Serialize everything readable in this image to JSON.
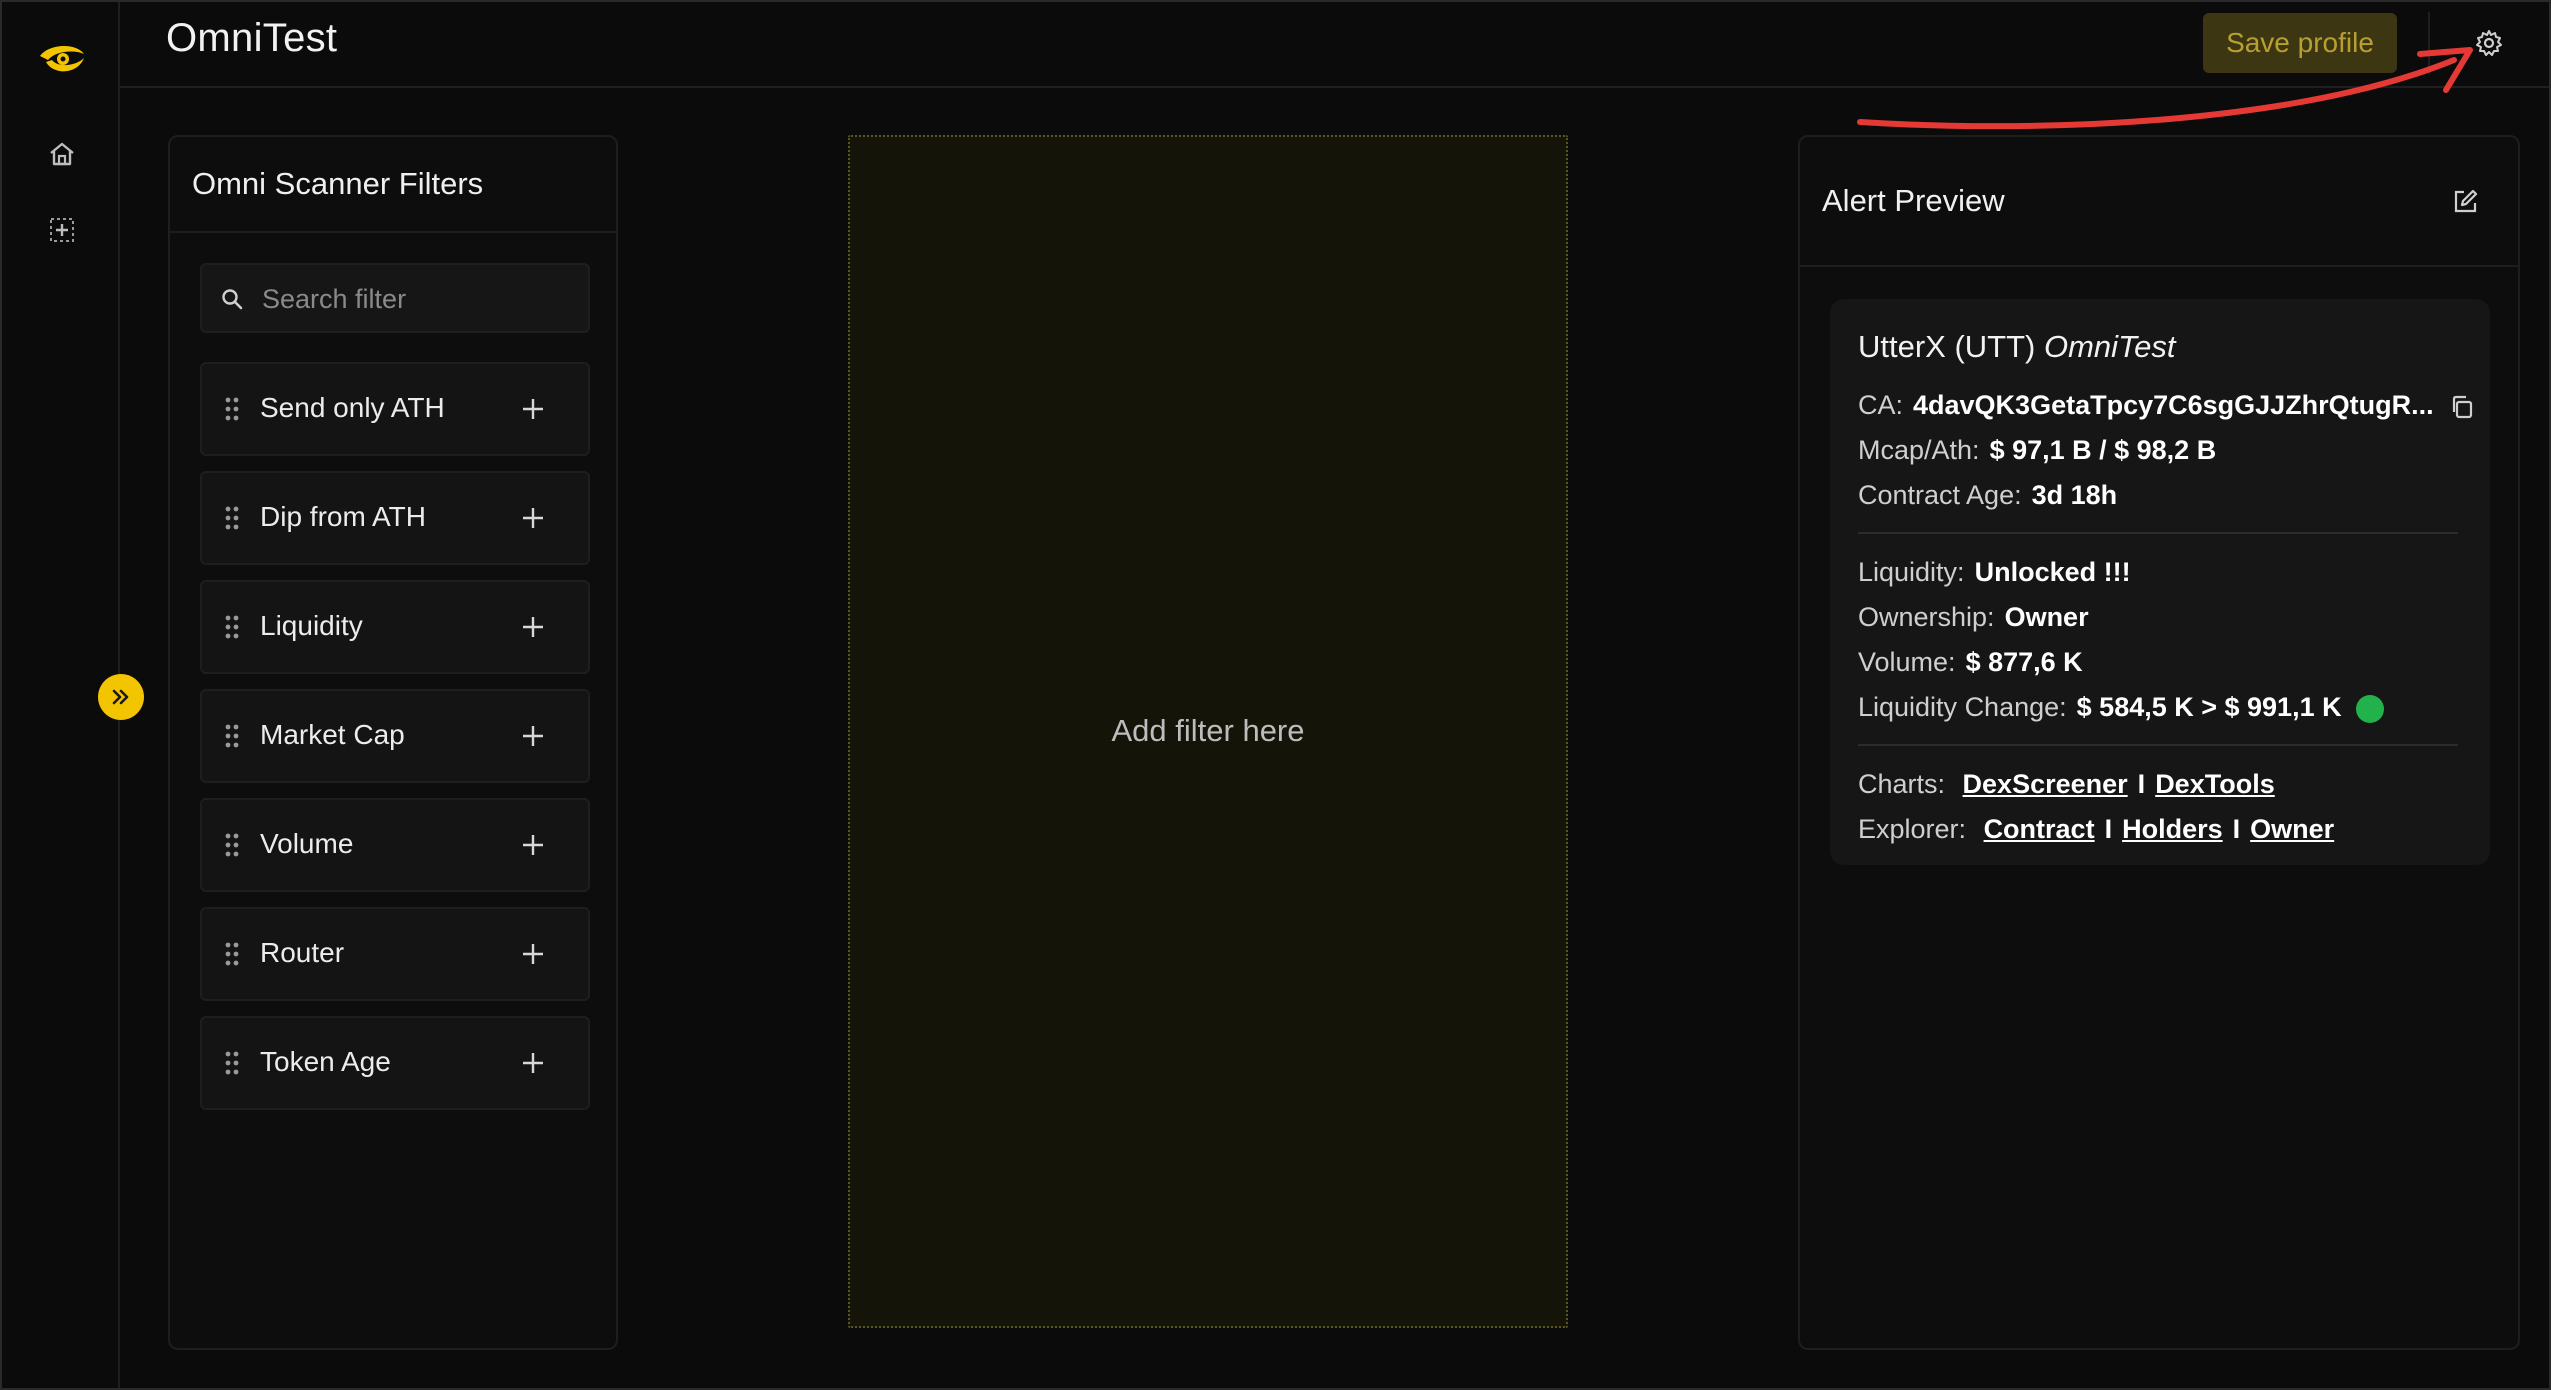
{
  "app": {
    "title": "OmniTest"
  },
  "toolbar": {
    "save_label": "Save profile"
  },
  "rail": {
    "icons": [
      "logo-icon",
      "home-icon",
      "dashboard-icon"
    ],
    "expand_icon": "chevron-double-right-icon"
  },
  "filters_panel": {
    "title": "Omni Scanner Filters",
    "search_placeholder": "Search filter",
    "items": [
      {
        "label": "Send only ATH"
      },
      {
        "label": "Dip from ATH"
      },
      {
        "label": "Liquidity"
      },
      {
        "label": "Market Cap"
      },
      {
        "label": "Volume"
      },
      {
        "label": "Router"
      },
      {
        "label": "Token Age"
      }
    ]
  },
  "dropzone": {
    "text": "Add filter here"
  },
  "alert_preview": {
    "title": "Alert Preview",
    "token_name": "UtterX (UTT)",
    "token_profile": "OmniTest",
    "ca_label": "CA:",
    "ca_value": "4davQK3GetaTpcy7C6sgGJJZhrQtugR...",
    "mcap_label": "Mcap/Ath:",
    "mcap_value": "$ 97,1 B / $ 98,2 B",
    "age_label": "Contract Age:",
    "age_value": "3d 18h",
    "liquidity_label": "Liquidity:",
    "liquidity_value": "Unlocked !!!",
    "ownership_label": "Ownership:",
    "ownership_value": "Owner",
    "volume_label": "Volume:",
    "volume_value": "$ 877,6 K",
    "liq_change_label": "Liquidity Change:",
    "liq_change_value": "$ 584,5 K > $ 991,1 K",
    "charts_label": "Charts:",
    "charts_links": [
      "DexScreener",
      "DexTools"
    ],
    "explorer_label": "Explorer:",
    "explorer_links": [
      "Contract",
      "Holders",
      "Owner"
    ],
    "separator": "I"
  },
  "colors": {
    "accent": "#f2c500",
    "save_bg": "#3d3613",
    "status_green": "#22b24c",
    "annotation_red": "#e53935"
  }
}
